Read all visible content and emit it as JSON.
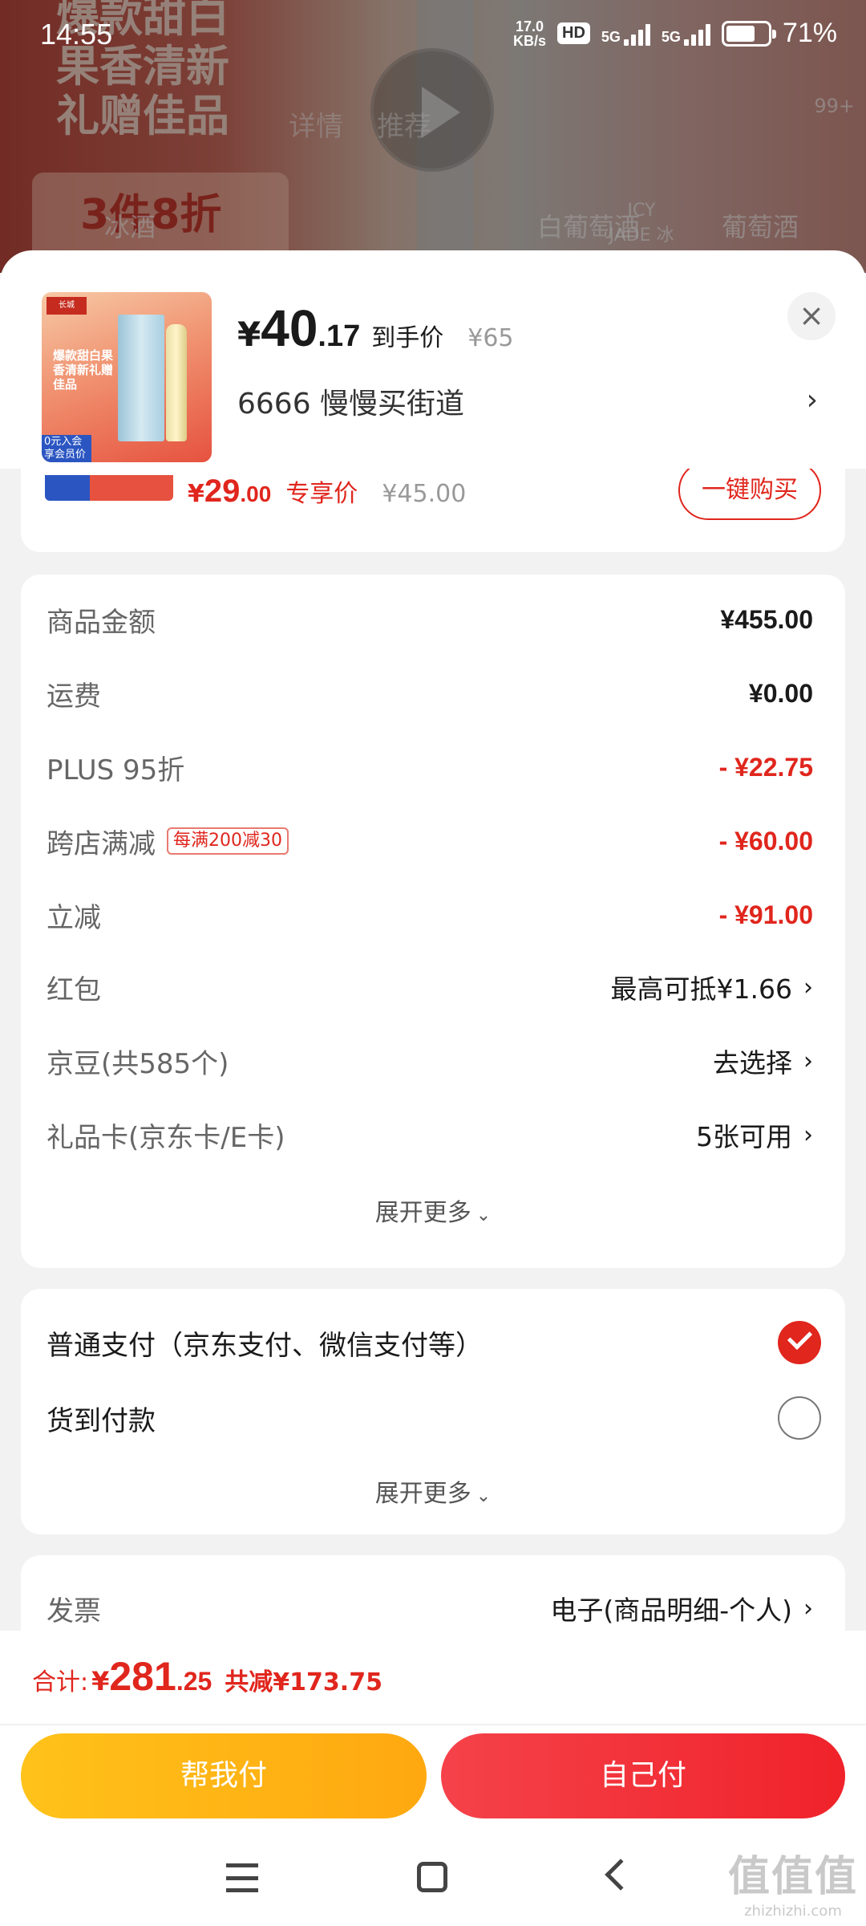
{
  "status_bar": {
    "time": "14:55",
    "net_speed_value": "17.0",
    "net_speed_unit": "KB/s",
    "hd_label": "HD",
    "sim1_label": "5G",
    "sim2_label": "5G",
    "battery_percent": "71%",
    "battery_level": 0.71
  },
  "background": {
    "promo_text": "爆款甜白果香清新礼赠佳品",
    "discount_text": "3件8折",
    "tab_details": "详情",
    "tab_recommend": "推荐",
    "cart_badge": "99+",
    "cat_1": "冰酒",
    "cat_2": "白葡萄酒",
    "cat_3": "ICY JADE 冰翠",
    "cat_4": "葡萄酒"
  },
  "product": {
    "currency": "¥",
    "price_int": "40",
    "price_dec": ".17",
    "price_label": "到手价",
    "original_price": "¥65",
    "address": "6666  慢慢买街道",
    "thumb_logo": "长城",
    "thumb_text": "爆款甜白果香清新礼赠佳品",
    "thumb_chip": "0元入会享会员价"
  },
  "peek_item": {
    "currency": "¥",
    "price_int": "29",
    "price_dec": ".00",
    "price_label": "专享价",
    "original_price": "¥45.00",
    "button_label": "一键购买"
  },
  "summary": {
    "rows": [
      {
        "label": "商品金额",
        "value": "¥455.00"
      },
      {
        "label": "运费",
        "value": "¥0.00"
      },
      {
        "label": "PLUS 95折",
        "value": "- ¥22.75"
      },
      {
        "label": "跨店满减",
        "tag": "每满200减30",
        "value": "- ¥60.00"
      },
      {
        "label": "立减",
        "value": "- ¥91.00"
      },
      {
        "label": "红包",
        "value": "最高可抵¥1.66"
      },
      {
        "label": "京豆(共585个)",
        "value": "去选择"
      },
      {
        "label": "礼品卡(京东卡/E卡)",
        "value": "5张可用"
      }
    ],
    "expand_label": "展开更多"
  },
  "payment": {
    "options": [
      {
        "label": "普通支付（京东支付、微信支付等）",
        "selected": true
      },
      {
        "label": "货到付款",
        "selected": false
      }
    ],
    "expand_label": "展开更多"
  },
  "invoice": {
    "label": "发票",
    "value": "电子(商品明细-个人)"
  },
  "footer": {
    "total_label": "合计:",
    "currency": "¥",
    "total_int": "281",
    "total_dec": ".25",
    "saved": "共减¥173.75",
    "help_pay_label": "帮我付",
    "self_pay_label": "自己付"
  },
  "watermark": {
    "main": "值值值",
    "sub": "zhizhizhi.com"
  },
  "colors": {
    "accent_red": "#e0261d",
    "help_btn": "#ffb316",
    "self_btn": "#f2323a"
  }
}
